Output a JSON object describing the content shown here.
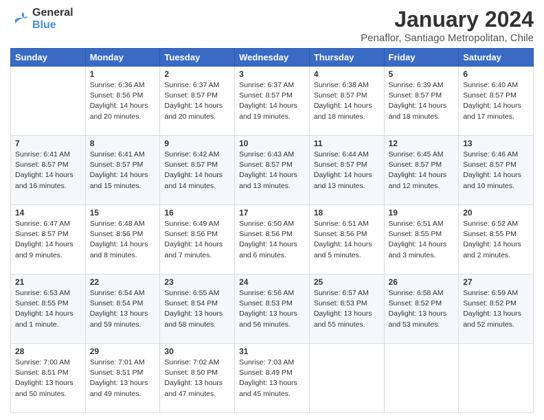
{
  "logo": {
    "line1": "General",
    "line2": "Blue"
  },
  "title": "January 2024",
  "location": "Penaflor, Santiago Metropolitan, Chile",
  "days_of_week": [
    "Sunday",
    "Monday",
    "Tuesday",
    "Wednesday",
    "Thursday",
    "Friday",
    "Saturday"
  ],
  "weeks": [
    [
      {
        "day": "",
        "info": ""
      },
      {
        "day": "1",
        "info": "Sunrise: 6:36 AM\nSunset: 8:56 PM\nDaylight: 14 hours\nand 20 minutes."
      },
      {
        "day": "2",
        "info": "Sunrise: 6:37 AM\nSunset: 8:57 PM\nDaylight: 14 hours\nand 20 minutes."
      },
      {
        "day": "3",
        "info": "Sunrise: 6:37 AM\nSunset: 8:57 PM\nDaylight: 14 hours\nand 19 minutes."
      },
      {
        "day": "4",
        "info": "Sunrise: 6:38 AM\nSunset: 8:57 PM\nDaylight: 14 hours\nand 18 minutes."
      },
      {
        "day": "5",
        "info": "Sunrise: 6:39 AM\nSunset: 8:57 PM\nDaylight: 14 hours\nand 18 minutes."
      },
      {
        "day": "6",
        "info": "Sunrise: 6:40 AM\nSunset: 8:57 PM\nDaylight: 14 hours\nand 17 minutes."
      }
    ],
    [
      {
        "day": "7",
        "info": "Sunrise: 6:41 AM\nSunset: 8:57 PM\nDaylight: 14 hours\nand 16 minutes."
      },
      {
        "day": "8",
        "info": "Sunrise: 6:41 AM\nSunset: 8:57 PM\nDaylight: 14 hours\nand 15 minutes."
      },
      {
        "day": "9",
        "info": "Sunrise: 6:42 AM\nSunset: 8:57 PM\nDaylight: 14 hours\nand 14 minutes."
      },
      {
        "day": "10",
        "info": "Sunrise: 6:43 AM\nSunset: 8:57 PM\nDaylight: 14 hours\nand 13 minutes."
      },
      {
        "day": "11",
        "info": "Sunrise: 6:44 AM\nSunset: 8:57 PM\nDaylight: 14 hours\nand 13 minutes."
      },
      {
        "day": "12",
        "info": "Sunrise: 6:45 AM\nSunset: 8:57 PM\nDaylight: 14 hours\nand 12 minutes."
      },
      {
        "day": "13",
        "info": "Sunrise: 6:46 AM\nSunset: 8:57 PM\nDaylight: 14 hours\nand 10 minutes."
      }
    ],
    [
      {
        "day": "14",
        "info": "Sunrise: 6:47 AM\nSunset: 8:57 PM\nDaylight: 14 hours\nand 9 minutes."
      },
      {
        "day": "15",
        "info": "Sunrise: 6:48 AM\nSunset: 8:56 PM\nDaylight: 14 hours\nand 8 minutes."
      },
      {
        "day": "16",
        "info": "Sunrise: 6:49 AM\nSunset: 8:56 PM\nDaylight: 14 hours\nand 7 minutes."
      },
      {
        "day": "17",
        "info": "Sunrise: 6:50 AM\nSunset: 8:56 PM\nDaylight: 14 hours\nand 6 minutes."
      },
      {
        "day": "18",
        "info": "Sunrise: 6:51 AM\nSunset: 8:56 PM\nDaylight: 14 hours\nand 5 minutes."
      },
      {
        "day": "19",
        "info": "Sunrise: 6:51 AM\nSunset: 8:55 PM\nDaylight: 14 hours\nand 3 minutes."
      },
      {
        "day": "20",
        "info": "Sunrise: 6:52 AM\nSunset: 8:55 PM\nDaylight: 14 hours\nand 2 minutes."
      }
    ],
    [
      {
        "day": "21",
        "info": "Sunrise: 6:53 AM\nSunset: 8:55 PM\nDaylight: 14 hours\nand 1 minute."
      },
      {
        "day": "22",
        "info": "Sunrise: 6:54 AM\nSunset: 8:54 PM\nDaylight: 13 hours\nand 59 minutes."
      },
      {
        "day": "23",
        "info": "Sunrise: 6:55 AM\nSunset: 8:54 PM\nDaylight: 13 hours\nand 58 minutes."
      },
      {
        "day": "24",
        "info": "Sunrise: 6:56 AM\nSunset: 8:53 PM\nDaylight: 13 hours\nand 56 minutes."
      },
      {
        "day": "25",
        "info": "Sunrise: 6:57 AM\nSunset: 8:53 PM\nDaylight: 13 hours\nand 55 minutes."
      },
      {
        "day": "26",
        "info": "Sunrise: 6:58 AM\nSunset: 8:52 PM\nDaylight: 13 hours\nand 53 minutes."
      },
      {
        "day": "27",
        "info": "Sunrise: 6:59 AM\nSunset: 8:52 PM\nDaylight: 13 hours\nand 52 minutes."
      }
    ],
    [
      {
        "day": "28",
        "info": "Sunrise: 7:00 AM\nSunset: 8:51 PM\nDaylight: 13 hours\nand 50 minutes."
      },
      {
        "day": "29",
        "info": "Sunrise: 7:01 AM\nSunset: 8:51 PM\nDaylight: 13 hours\nand 49 minutes."
      },
      {
        "day": "30",
        "info": "Sunrise: 7:02 AM\nSunset: 8:50 PM\nDaylight: 13 hours\nand 47 minutes."
      },
      {
        "day": "31",
        "info": "Sunrise: 7:03 AM\nSunset: 8:49 PM\nDaylight: 13 hours\nand 45 minutes."
      },
      {
        "day": "",
        "info": ""
      },
      {
        "day": "",
        "info": ""
      },
      {
        "day": "",
        "info": ""
      }
    ]
  ]
}
